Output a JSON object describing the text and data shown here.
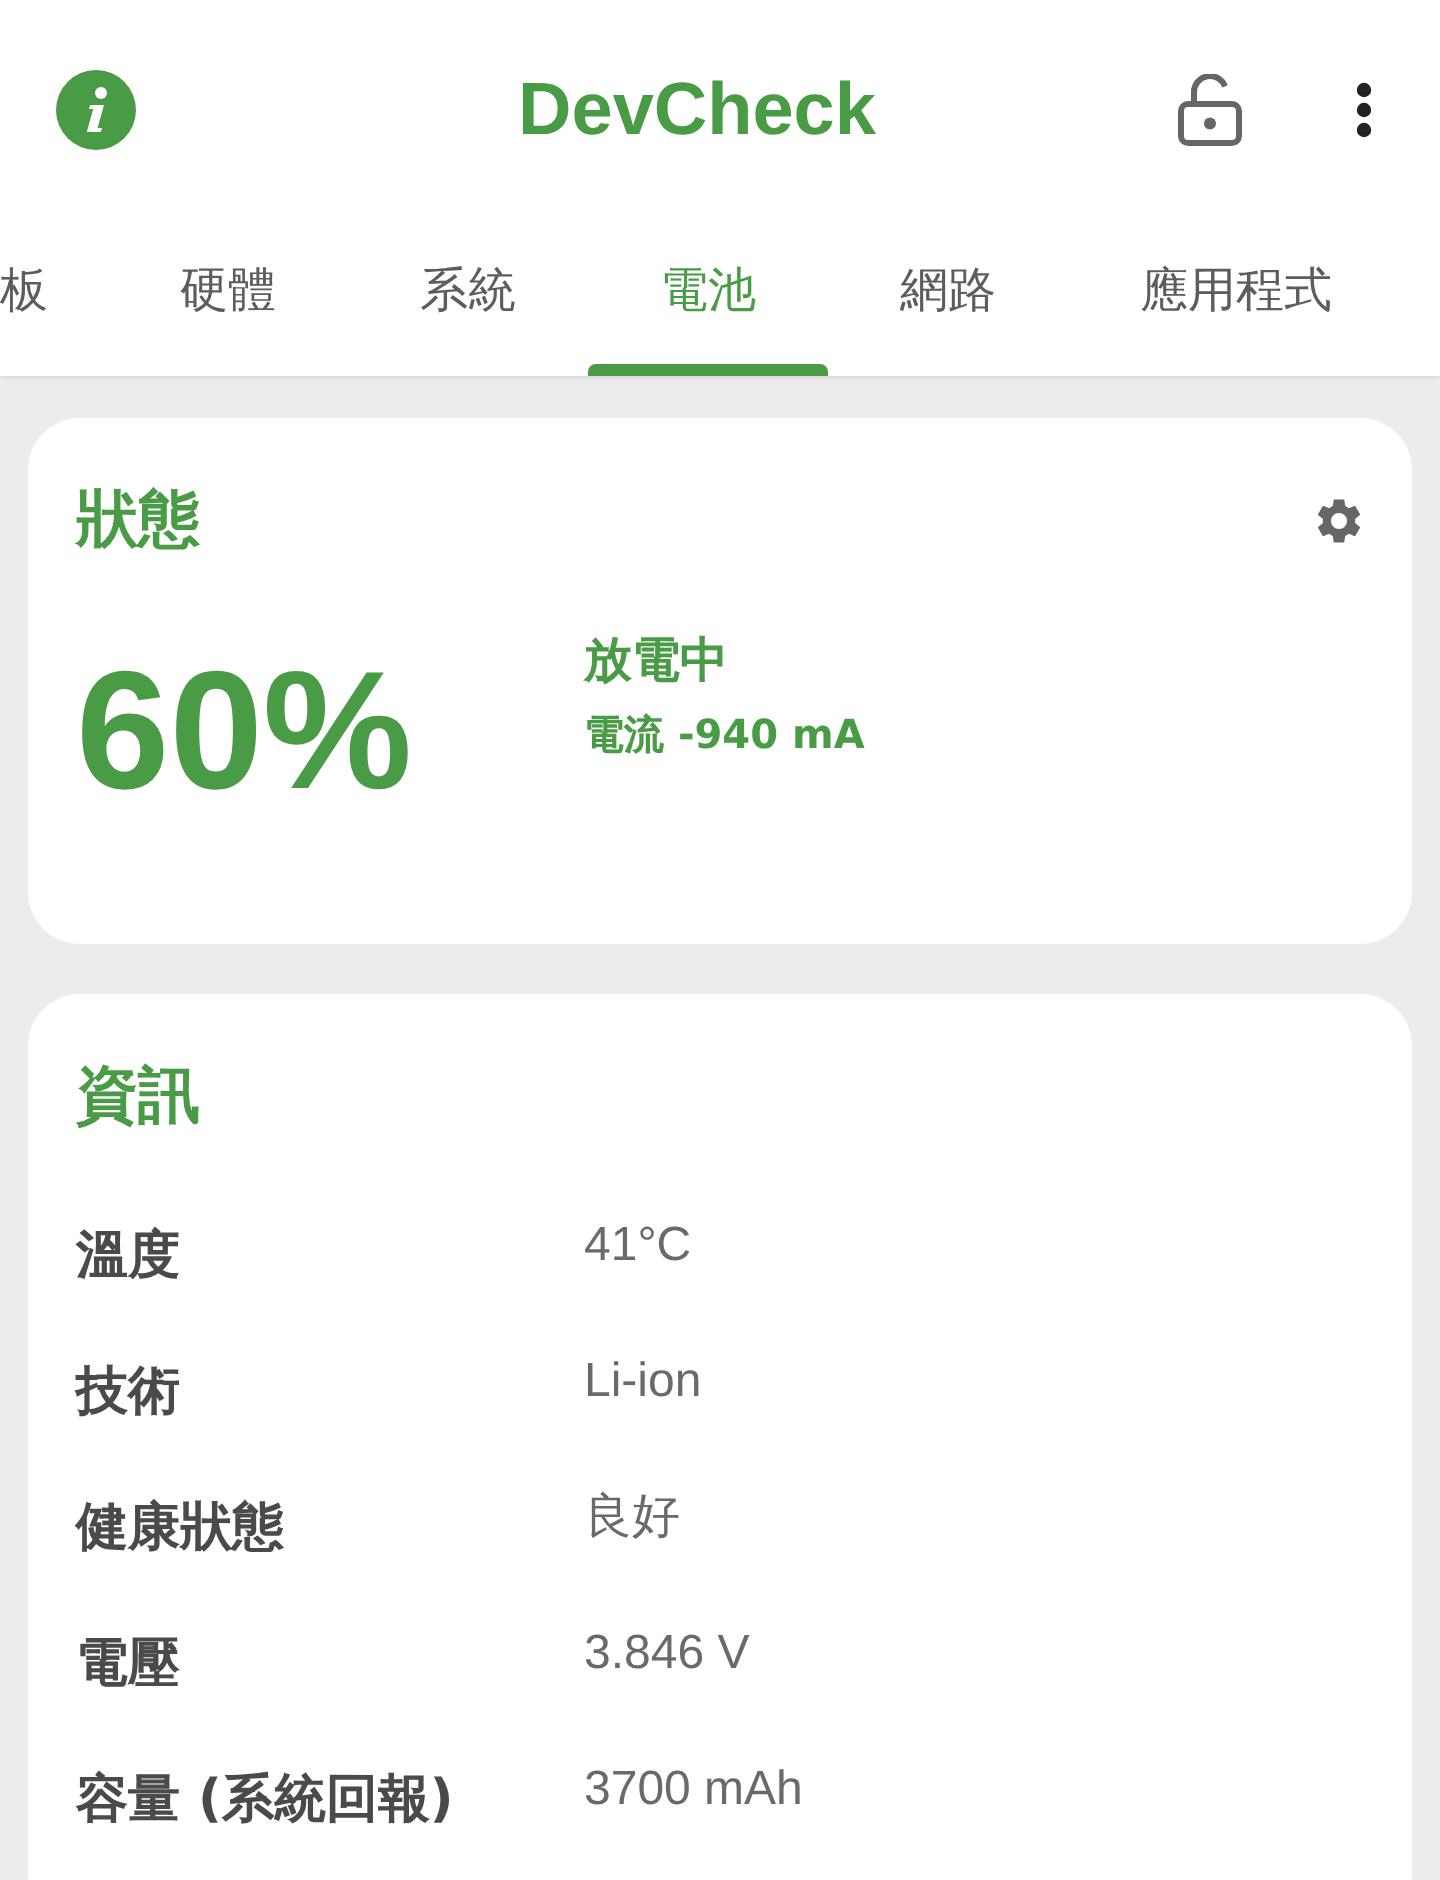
{
  "app_bar": {
    "title": "DevCheck"
  },
  "tabs": [
    {
      "label": "板",
      "selected": false
    },
    {
      "label": "硬體",
      "selected": false
    },
    {
      "label": "系統",
      "selected": false
    },
    {
      "label": "電池",
      "selected": true
    },
    {
      "label": "網路",
      "selected": false
    },
    {
      "label": "應用程式",
      "selected": false
    }
  ],
  "status_card": {
    "title": "狀態",
    "charge": "60%",
    "state": "放電中",
    "current": "電流 -940 mA"
  },
  "info_card": {
    "title": "資訊",
    "rows": [
      {
        "label": "溫度",
        "value": "41°C"
      },
      {
        "label": "技術",
        "value": "Li-ion"
      },
      {
        "label": "健康狀態",
        "value": "良好"
      },
      {
        "label": "電壓",
        "value": "3.846 V"
      },
      {
        "label": "容量 (系統回報)",
        "value": "3700 mAh"
      }
    ]
  }
}
